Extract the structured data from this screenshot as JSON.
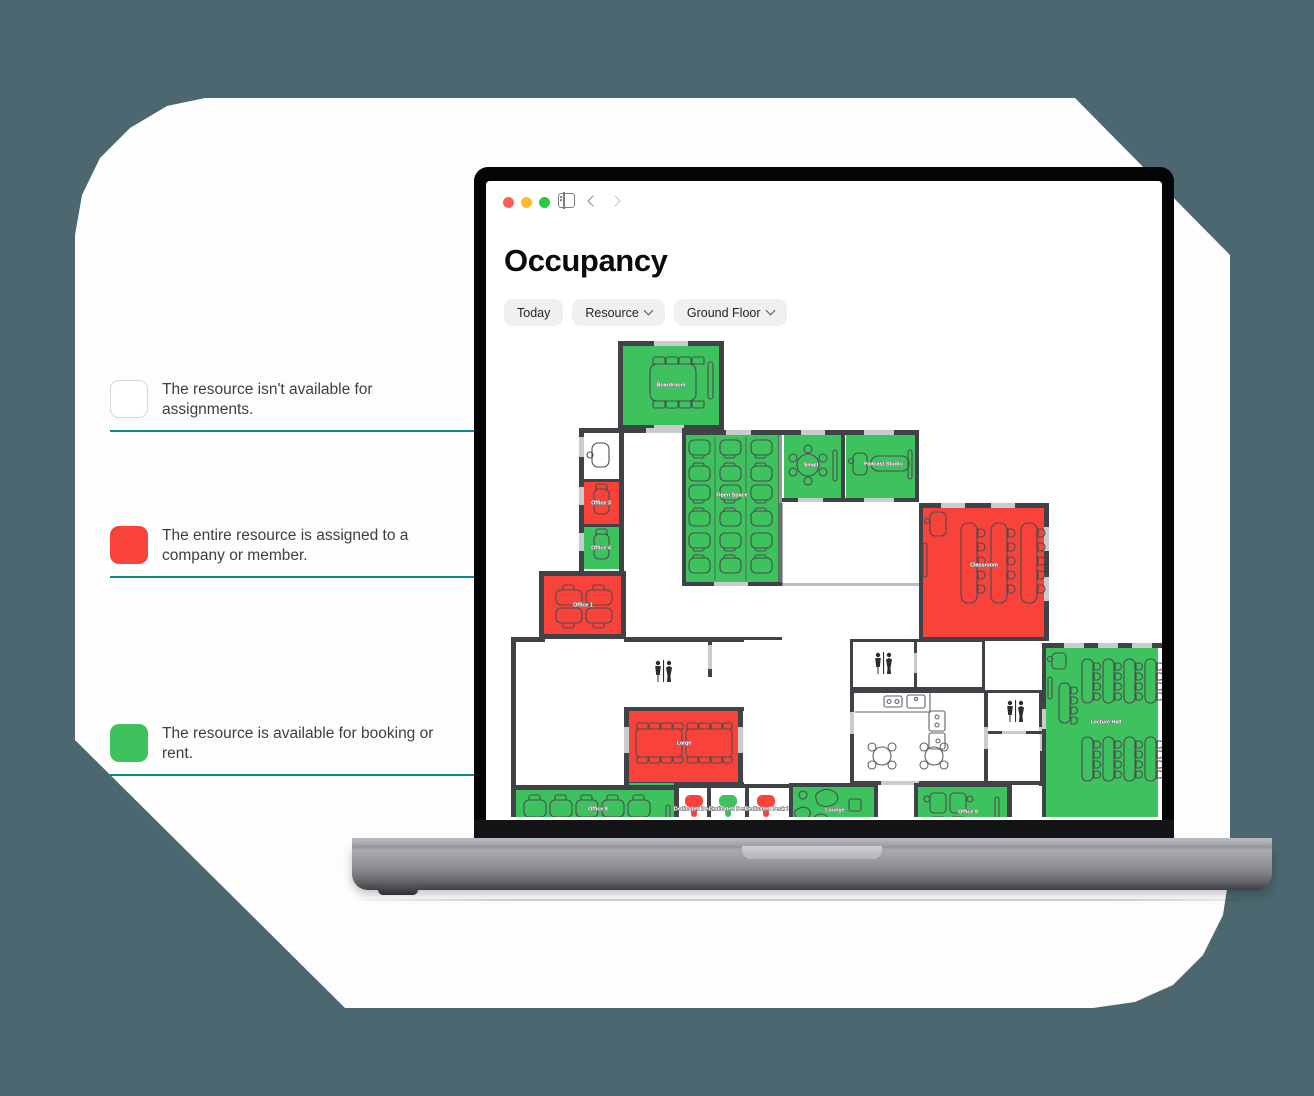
{
  "theme": {
    "background": "#4c676f",
    "card": "#fdfdfd",
    "accent_line": "#0a8b8b",
    "available": "#3ec25e",
    "assigned": "#f9423a",
    "unavailable": "#ffffff",
    "wall": "#3f4246"
  },
  "browser": {
    "traffic_lights": [
      "close-red",
      "minimize-yellow",
      "zoom-green"
    ],
    "sidebar_icon": "sidebar-icon",
    "back_label": "Back",
    "forward_label": "Forward"
  },
  "page": {
    "title": "Occupancy",
    "filters": [
      {
        "label": "Today",
        "has_chevron": false,
        "name": "filter-today"
      },
      {
        "label": "Resource",
        "has_chevron": true,
        "name": "filter-resource"
      },
      {
        "label": "Ground Floor",
        "has_chevron": true,
        "name": "filter-floor"
      }
    ]
  },
  "legend": [
    {
      "swatch": "none",
      "color": "#ffffff",
      "text": "The resource isn't available for assignments."
    },
    {
      "swatch": "assigned",
      "color": "#f9423a",
      "text": "The entire resource is assigned to a company or member."
    },
    {
      "swatch": "available",
      "color": "#3ec25e",
      "text": "The resource is available for booking or rent."
    }
  ],
  "floorplan": {
    "floor": "Ground Floor",
    "rooms": [
      {
        "name": "Boardroom",
        "status": "available",
        "label": "Boardroom"
      },
      {
        "name": "phone-booth",
        "status": "unavailable",
        "label": ""
      },
      {
        "name": "Office 3",
        "status": "assigned",
        "label": "Office 3"
      },
      {
        "name": "Office 4",
        "status": "available",
        "label": "Office 4"
      },
      {
        "name": "Office 1",
        "status": "assigned",
        "label": "Office 1"
      },
      {
        "name": "Open Space",
        "status": "available",
        "label": "Open Space"
      },
      {
        "name": "Small",
        "status": "available",
        "label": "Small"
      },
      {
        "name": "Podcast Studio",
        "status": "available",
        "label": "Podcast Studio"
      },
      {
        "name": "Classroom",
        "status": "assigned",
        "label": "Classroom"
      },
      {
        "name": "Large",
        "status": "assigned",
        "label": "Large"
      },
      {
        "name": "Office 8",
        "status": "available",
        "label": "Office 8"
      },
      {
        "name": "Dedicated Desk 1",
        "status": "assigned",
        "label": "Dedicated Desk"
      },
      {
        "name": "Dedicated Desk 2",
        "status": "available",
        "label": "Dedicated Desk"
      },
      {
        "name": "Dedicated Desk 3",
        "status": "assigned",
        "label": "Dedicated Desk 3"
      },
      {
        "name": "Lounge",
        "status": "available",
        "label": "Lounge"
      },
      {
        "name": "Office 9",
        "status": "available",
        "label": "Office 9"
      },
      {
        "name": "Lecture Hall",
        "status": "available",
        "label": "Lecture Hall"
      },
      {
        "name": "restroom-north",
        "status": "unavailable",
        "label": ""
      },
      {
        "name": "restroom-west",
        "status": "unavailable",
        "label": ""
      },
      {
        "name": "restroom-east",
        "status": "unavailable",
        "label": ""
      },
      {
        "name": "kitchen",
        "status": "unavailable",
        "label": ""
      }
    ]
  }
}
